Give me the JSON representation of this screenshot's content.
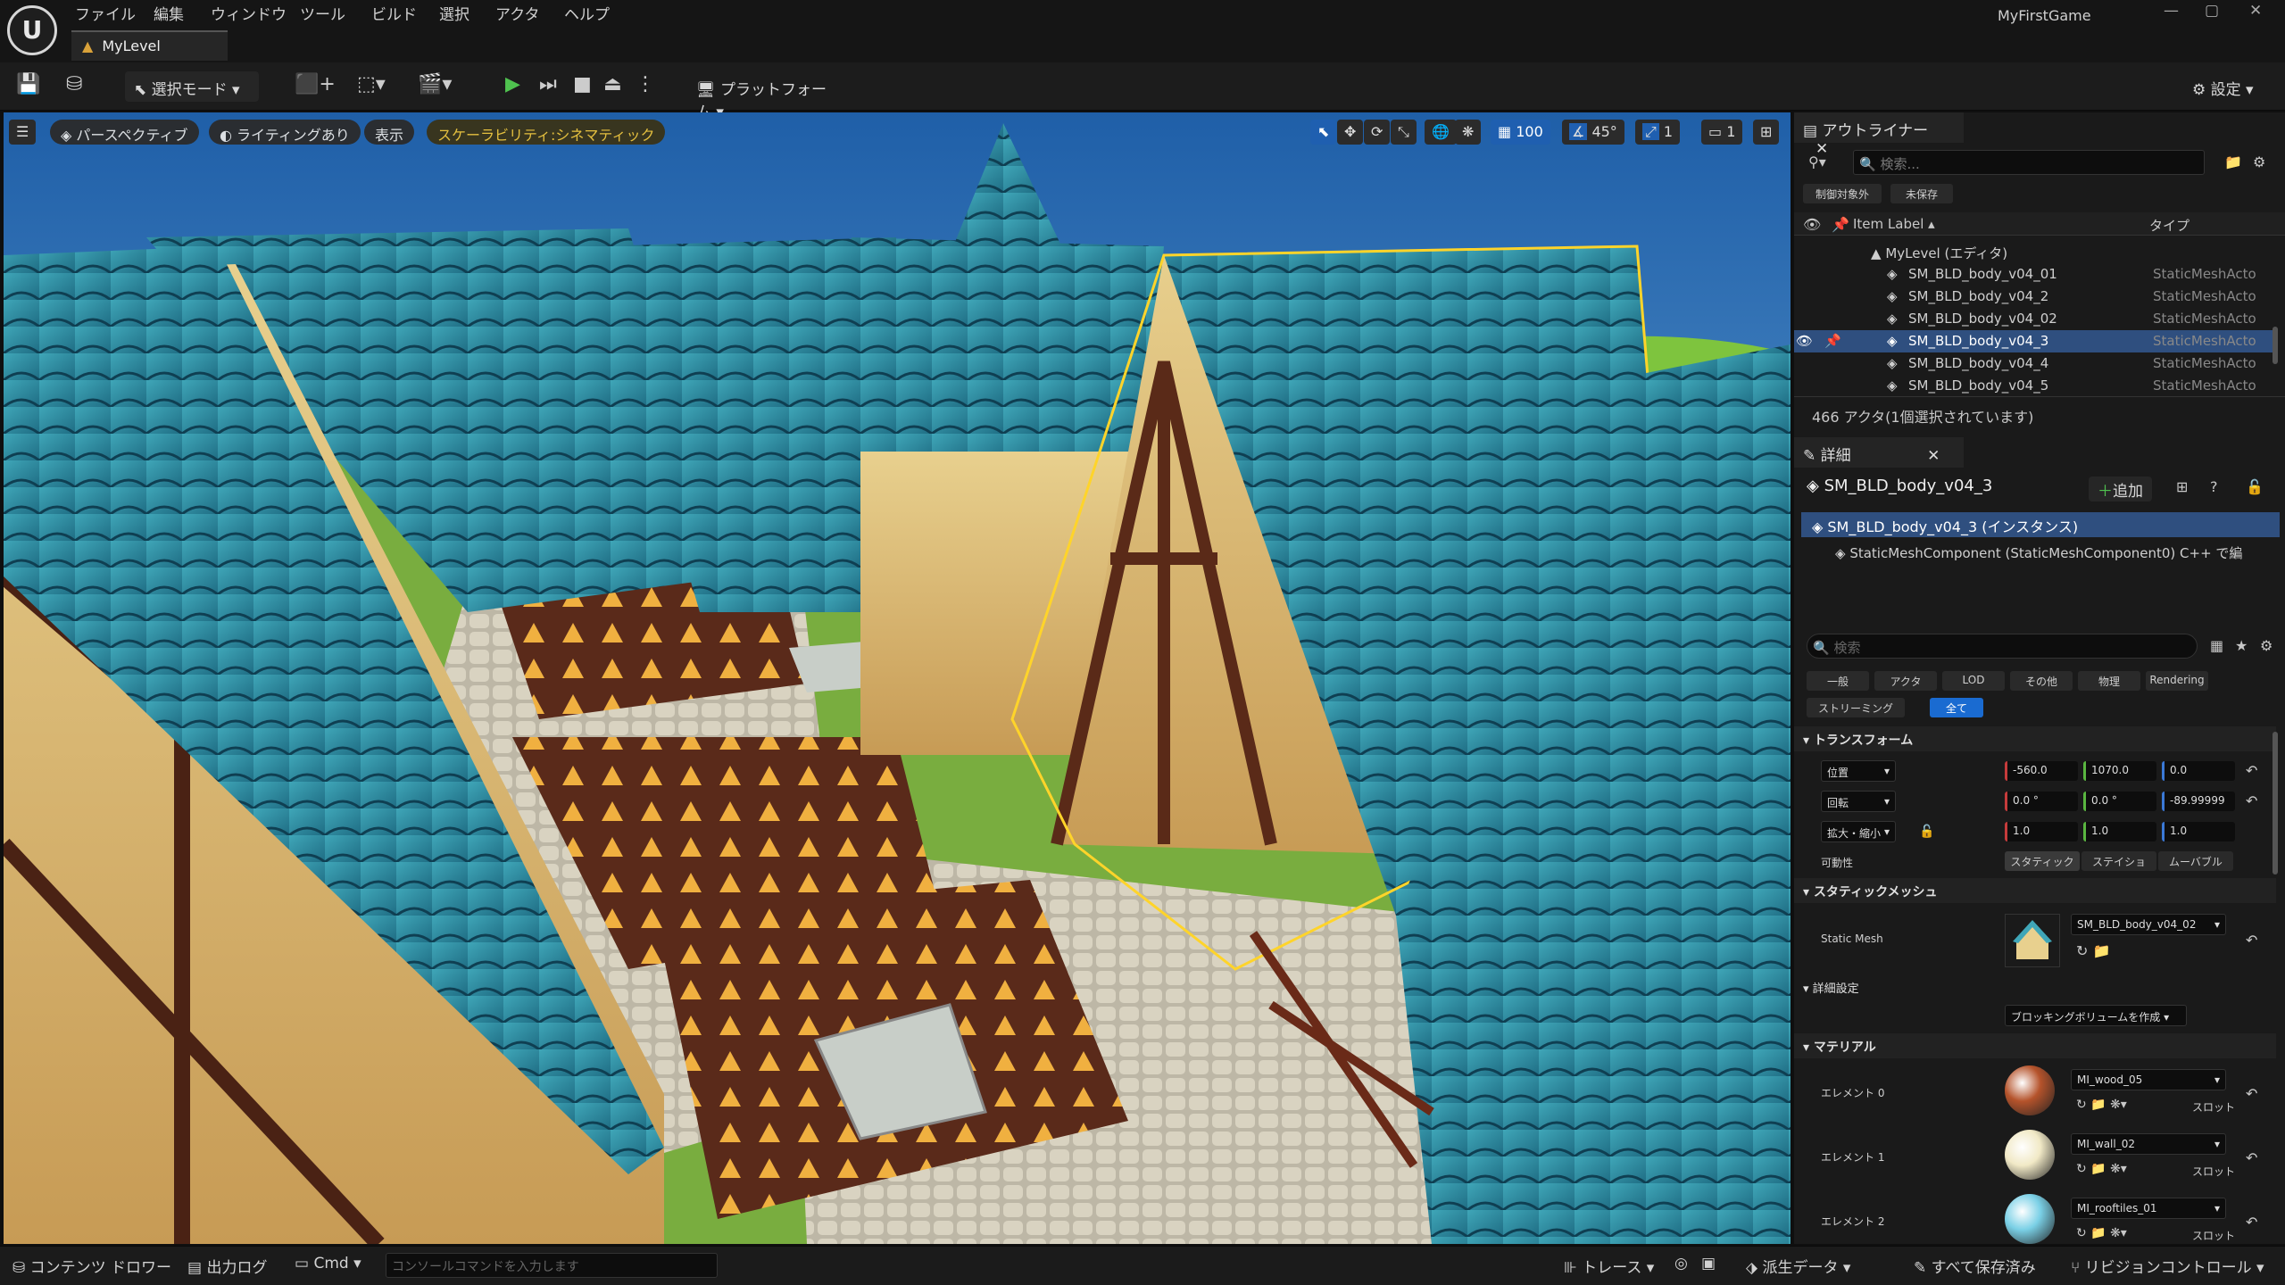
{
  "app": {
    "logo": "U",
    "project_title": "MyFirstGame",
    "level_tab": "MyLevel"
  },
  "menu": [
    "ファイル",
    "編集",
    "ウィンドウ",
    "ツール",
    "ビルド",
    "選択",
    "アクタ",
    "ヘルプ"
  ],
  "window_buttons": [
    "—",
    "▢",
    "✕"
  ],
  "toolbar": {
    "save_icon": "💾",
    "content_icon": "⛁",
    "select_mode": "選択モード",
    "add_icon": "add-actor-icon",
    "play": "▶",
    "step": "⏭",
    "stop": "■",
    "eject": "⏏",
    "more": "⋮",
    "platform": "プラットフォーム",
    "settings": "設定"
  },
  "viewport": {
    "menu_icon": "☰",
    "perspective": "パースペクティブ",
    "lighting": "ライティングあり",
    "show": "表示",
    "scalability": "スケーラビリティ:シネマティック",
    "grid_value": "100",
    "angle_value": "45°",
    "scale_value": "1",
    "camera_speed": "1"
  },
  "outliner": {
    "tab": "アウトライナー",
    "search_placeholder": "検索...",
    "filter_a": "制御対象外",
    "filter_b": "未保存",
    "col_label": "Item Label ▴",
    "col_type": "タイプ",
    "root": "MyLevel (エディタ)",
    "rows": [
      {
        "label": "SM_BLD_body_v04_01",
        "type": "StaticMeshActo"
      },
      {
        "label": "SM_BLD_body_v04_2",
        "type": "StaticMeshActo"
      },
      {
        "label": "SM_BLD_body_v04_02",
        "type": "StaticMeshActo"
      },
      {
        "label": "SM_BLD_body_v04_3",
        "type": "StaticMeshActo"
      },
      {
        "label": "SM_BLD_body_v04_4",
        "type": "StaticMeshActo"
      },
      {
        "label": "SM_BLD_body_v04_5",
        "type": "StaticMeshActo"
      }
    ],
    "selected_index": 3,
    "count": "466 アクタ(1個選択されています)"
  },
  "details": {
    "tab": "詳細",
    "actor_name": "SM_BLD_body_v04_3",
    "add": "追加",
    "cpp": "C++ で編",
    "instance": "SM_BLD_body_v04_3 (インスタンス)",
    "component": "StaticMeshComponent (StaticMeshComponent0)",
    "search_placeholder": "検索",
    "filters_row1": [
      "一般",
      "アクタ",
      "LOD",
      "その他",
      "物理",
      "Rendering"
    ],
    "filters_row2": [
      "ストリーミング",
      "全て"
    ],
    "transform": {
      "header": "トランスフォーム",
      "location": {
        "label": "位置",
        "x": "-560.0",
        "y": "1070.0",
        "z": "0.0"
      },
      "rotation": {
        "label": "回転",
        "x": "0.0 °",
        "y": "0.0 °",
        "z": "-89.99999"
      },
      "scale": {
        "label": "拡大・縮小",
        "x": "1.0",
        "y": "1.0",
        "z": "1.0"
      },
      "mobility": {
        "label": "可動性",
        "options": [
          "スタティック",
          "ステイショ",
          "ムーバブル"
        ]
      }
    },
    "static_mesh": {
      "header": "スタティックメッシュ",
      "label": "Static Mesh",
      "value": "SM_BLD_body_v04_02"
    },
    "advanced": {
      "header": "詳細設定",
      "button": "ブロッキングボリュームを作成"
    },
    "materials": {
      "header": "マテリアル",
      "slot": "スロット",
      "items": [
        {
          "label": "エレメント 0",
          "value": "MI_wood_05",
          "color": "#b5532b"
        },
        {
          "label": "エレメント 1",
          "value": "MI_wall_02",
          "color": "#f1e9c6"
        },
        {
          "label": "エレメント 2",
          "value": "MI_rooftiles_01",
          "color": "#7ad0e6"
        }
      ]
    }
  },
  "statusbar": {
    "content_drawer": "コンテンツ ドロワー",
    "output_log": "出力ログ",
    "cmd": "Cmd",
    "console_placeholder": "コンソールコマンドを入力します",
    "trace": "トレース",
    "derived_data": "派生データ",
    "save_all": "すべて保存済み",
    "revision": "リビジョンコントロール"
  }
}
